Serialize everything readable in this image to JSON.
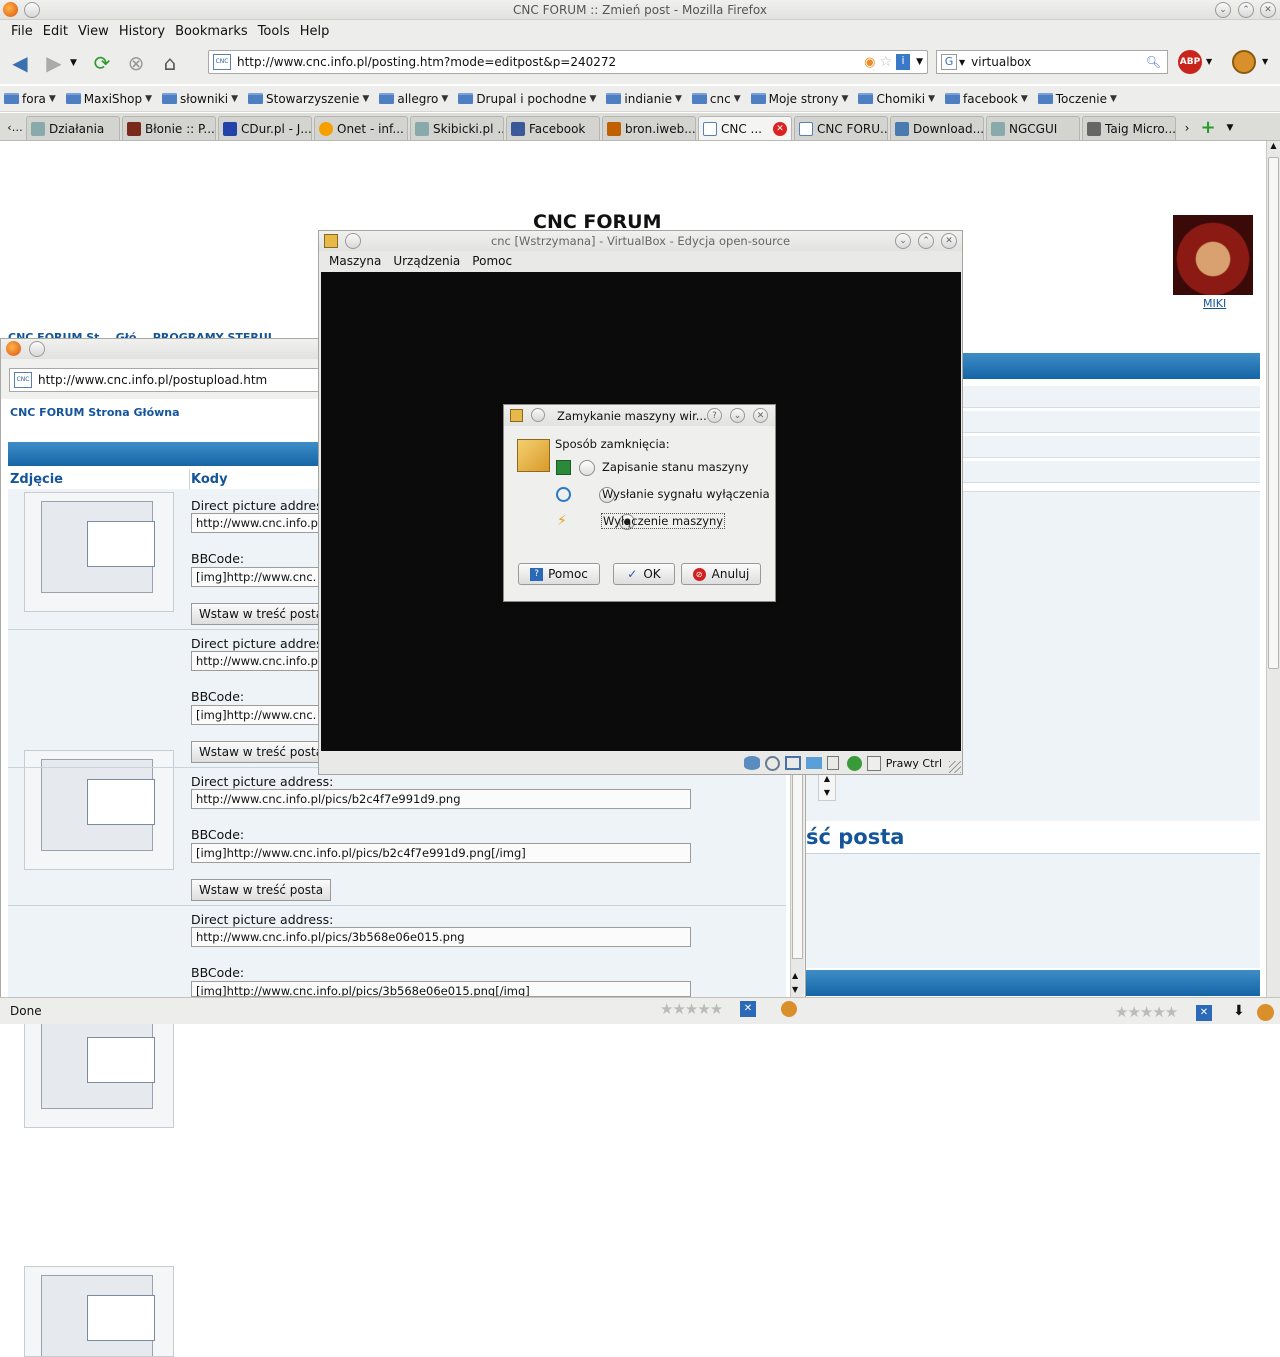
{
  "window": {
    "title": "CNC FORUM :: Zmień post - Mozilla Firefox"
  },
  "menu": [
    "File",
    "Edit",
    "View",
    "History",
    "Bookmarks",
    "Tools",
    "Help"
  ],
  "nav": {
    "url": "http://www.cnc.info.pl/posting.htm?mode=editpost&p=240272",
    "search_value": "virtualbox"
  },
  "bookmarks": [
    "fora",
    "MaxiShop",
    "słowniki",
    "Stowarzyszenie",
    "allegro",
    "Drupal i pochodne",
    "indianie",
    "cnc",
    "Moje strony",
    "Chomiki",
    "facebook",
    "Toczenie"
  ],
  "tabs": [
    "Działania",
    "Błonie :: P...",
    "CDur.pl - J...",
    "Onet - inf...",
    "Skibicki.pl ...",
    "Facebook",
    "bron.iweb....",
    "CNC ...",
    "CNC FORU...",
    "Download...",
    "NGCGUI",
    "Taig Micro..."
  ],
  "page": {
    "heading": "CNC FORUM",
    "user": "MIKI",
    "section_heading_partial": "ść posta",
    "partial_nav": "CNC FORUM St... Głó... PROGRAMY STERUJ..."
  },
  "popup": {
    "url": "http://www.cnc.info.pl/postupload.htm",
    "home_link": "CNC FORUM Strona Główna",
    "col_photo": "Zdjęcie",
    "col_codes": "Kody",
    "direct_label": "Direct picture address:",
    "bbcode_label": "BBCode:",
    "insert_button": "Wstaw w treść posta",
    "rows": [
      {
        "direct": "http://www.cnc.info.p",
        "bbcode": "[img]http://www.cnc."
      },
      {
        "direct": "http://www.cnc.info.p",
        "bbcode": "[img]http://www.cnc."
      },
      {
        "direct": "http://www.cnc.info.pl/pics/b2c4f7e991d9.png",
        "bbcode": "[img]http://www.cnc.info.pl/pics/b2c4f7e991d9.png[/img]"
      },
      {
        "direct": "http://www.cnc.info.pl/pics/3b568e06e015.png",
        "bbcode": "[img]http://www.cnc.info.pl/pics/3b568e06e015.png[/img]"
      }
    ]
  },
  "vbox": {
    "title": "cnc [Wstrzymana] - VirtualBox - Edycja open-source",
    "menu": [
      "Maszyna",
      "Urządzenia",
      "Pomoc"
    ],
    "host_key": "Prawy Ctrl"
  },
  "dialog": {
    "title": "Zamykanie maszyny wir...",
    "prompt": "Sposób zamknięcia:",
    "options": [
      "Zapisanie stanu maszyny",
      "Wysłanie sygnału wyłączenia",
      "Wyłączenie maszyny"
    ],
    "selected_option": "Wyłączenie maszyny",
    "help_btn": "Pomoc",
    "ok_btn": "OK",
    "cancel_btn": "Anuluj"
  },
  "status": {
    "text": "Done"
  }
}
